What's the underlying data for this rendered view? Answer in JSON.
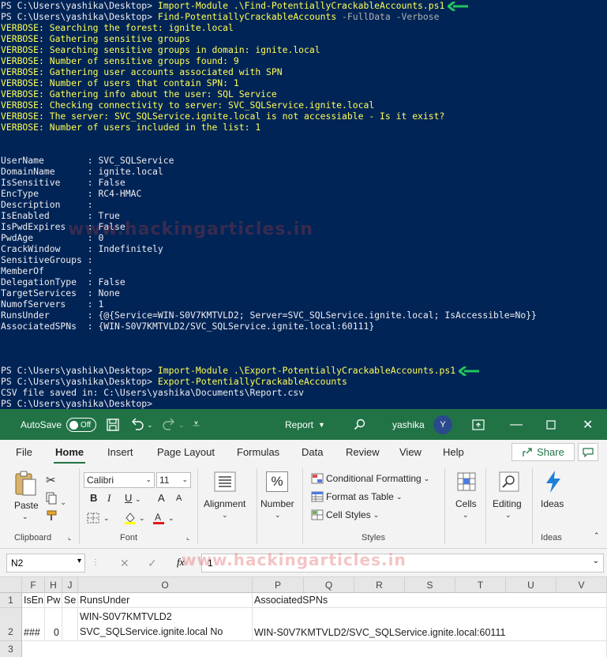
{
  "console": {
    "prompt": "PS C:\\Users\\yashika\\Desktop> ",
    "block1": {
      "cmd1": "Import-Module .\\Find-PotentiallyCrackableAccounts.ps1",
      "cmd2": "Find-PotentiallyCrackableAccounts",
      "cmd2_params": " -FullData -Verbose",
      "verbose": [
        "VERBOSE: Searching the forest: ignite.local",
        "VERBOSE: Gathering sensitive groups",
        "VERBOSE: Searching sensitive groups in domain: ignite.local",
        "VERBOSE: Number of sensitive groups found: 9",
        "VERBOSE: Gathering user accounts associated with SPN",
        "VERBOSE: Number of users that contain SPN: 1",
        "VERBOSE: Gathering info about the user: SQL Service",
        "VERBOSE: Checking connectivity to server: SVC_SQLService.ignite.local",
        "VERBOSE: The server: SVC_SQLService.ignite.local is not accessiable - Is it exist?",
        "VERBOSE: Number of users included in the list: 1"
      ]
    },
    "properties": [
      "UserName        : SVC_SQLService",
      "DomainName      : ignite.local",
      "IsSensitive     : False",
      "EncType         : RC4-HMAC",
      "Description     :",
      "IsEnabled       : True",
      "IsPwdExpires    : False",
      "PwdAge          : 0",
      "CrackWindow     : Indefinitely",
      "SensitiveGroups :",
      "MemberOf        :",
      "DelegationType  : False",
      "TargetServices  : None",
      "NumofServers    : 1",
      "RunsUnder       : {@{Service=WIN-S0V7KMTVLD2; Server=SVC_SQLService.ignite.local; IsAccessible=No}}",
      "AssociatedSPNs  : {WIN-S0V7KMTVLD2/SVC_SQLService.ignite.local:60111}"
    ],
    "block2": {
      "cmd1": "Import-Module .\\Export-PotentiallyCrackableAccounts.ps1",
      "cmd2": "Export-PotentiallyCrackableAccounts",
      "output": "CSV file saved in: C:\\Users\\yashika\\Documents\\Report.csv"
    },
    "watermark": "www.hackingarticles.in",
    "arrow_color": "#22c55e"
  },
  "excel": {
    "autosave_label": "AutoSave",
    "autosave_state": "Off",
    "doc_title": "Report",
    "user_name": "yashika",
    "user_initial": "Y",
    "menu": [
      "File",
      "Home",
      "Insert",
      "Page Layout",
      "Formulas",
      "Data",
      "Review",
      "View",
      "Help"
    ],
    "share_label": "Share",
    "ribbon": {
      "paste": "Paste",
      "clipboard": "Clipboard",
      "font_name": "Calibri",
      "font_size": "11",
      "font": "Font",
      "bold": "B",
      "italic": "I",
      "underline": "U",
      "grow": "A",
      "shrink": "A",
      "alignment": "Alignment",
      "number": "Number",
      "number_symbol": "%",
      "conditional": "Conditional Formatting",
      "format_table": "Format as Table",
      "cell_styles": "Cell Styles",
      "styles": "Styles",
      "cells": "Cells",
      "editing": "Editing",
      "ideas": "Ideas",
      "ideas_group": "Ideas"
    },
    "name_box": "N2",
    "formula_value": "1",
    "fx": "fx",
    "columns": [
      "F",
      "H",
      "J",
      "O",
      "P",
      "Q",
      "R",
      "S",
      "T",
      "U",
      "V"
    ],
    "rows": [
      "1",
      "2",
      "3"
    ],
    "row1": {
      "F": "IsEn",
      "H": "Pw",
      "J": "Se",
      "O": "RunsUnder",
      "P": "AssociatedSPNs"
    },
    "row2": {
      "F": "###",
      "H": "0",
      "O_line1": "WIN-S0V7KMTVLD2",
      "O_line2": "SVC_SQLService.ignite.local No",
      "P": "WIN-S0V7KMTVLD2/SVC_SQLService.ignite.local:60111"
    },
    "theme_color": "#217346"
  }
}
